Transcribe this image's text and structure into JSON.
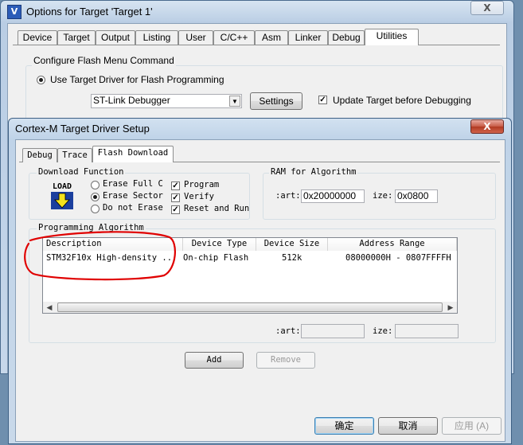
{
  "options_window": {
    "title": "Options for Target 'Target 1'",
    "close": "X",
    "tabs": [
      "Device",
      "Target",
      "Output",
      "Listing",
      "User",
      "C/C++",
      "Asm",
      "Linker",
      "Debug",
      "Utilities"
    ],
    "active_tab": "Utilities",
    "flash_group_label": "Configure Flash Menu Command",
    "use_target_driver_label": "Use Target Driver for Flash Programming",
    "driver_select_value": "ST-Link Debugger",
    "settings_button": "Settings",
    "update_target_label": "Update Target before Debugging"
  },
  "driver_setup": {
    "title": "Cortex-M Target Driver Setup",
    "close": "X",
    "tabs": [
      "Debug",
      "Trace",
      "Flash Download"
    ],
    "active_tab": "Flash Download",
    "download_function": {
      "label": "Download Function",
      "load_icon_text": "LOAD",
      "radios": [
        "Erase Full C",
        "Erase Sector",
        "Do not Erase"
      ],
      "selected_radio": "Erase Sector",
      "checks": [
        "Program",
        "Verify",
        "Reset and Run"
      ]
    },
    "ram": {
      "label": "RAM for Algorithm",
      "start_label": ":art:",
      "start_value": "0x20000000",
      "size_label": "ize:",
      "size_value": "0x0800"
    },
    "algorithm": {
      "label": "Programming Algorithm",
      "columns": [
        "Description",
        "Device Type",
        "Device Size",
        "Address Range"
      ],
      "rows": [
        {
          "description": "STM32F10x High-density ...",
          "type": "On-chip Flash",
          "size": "512k",
          "range": "08000000H - 0807FFFFH"
        }
      ],
      "start_label": ":art:",
      "size_label": "ize:"
    },
    "add_button": "Add",
    "remove_button": "Remove",
    "ok_button": "确定",
    "cancel_button": "取消",
    "apply_button": "应用 (A)"
  },
  "annotation_color": "#e00000"
}
